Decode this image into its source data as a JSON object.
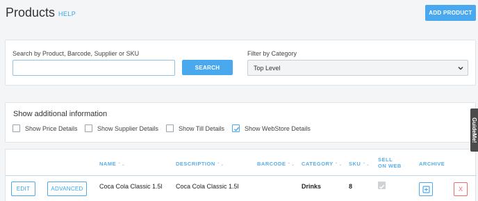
{
  "header": {
    "title": "Products",
    "help_label": "HELP",
    "add_label": "ADD PRODUCT"
  },
  "search": {
    "label": "Search by Product, Barcode, Supplier or SKU",
    "value": "",
    "button_label": "SEARCH",
    "filter_label": "Filter by Category",
    "filter_value": "Top Level"
  },
  "additional_info": {
    "title": "Show additional information",
    "options": [
      {
        "label": "Show Price Details",
        "checked": false
      },
      {
        "label": "Show Supplier Details",
        "checked": false
      },
      {
        "label": "Show Till Details",
        "checked": false
      },
      {
        "label": "Show WebStore Details",
        "checked": true
      }
    ]
  },
  "table": {
    "columns": {
      "name": "NAME",
      "description": "DESCRIPTION",
      "barcode": "BARCODE",
      "category": "CATEGORY",
      "sku": "SKU",
      "sell_on_web_1": "SELL",
      "sell_on_web_2": "ON WEB",
      "archive": "ARCHIVE"
    },
    "sort_glyph": "⌃⌄",
    "rows": [
      {
        "edit_label": "EDIT",
        "advanced_label": "ADVANCED",
        "name": "Coca Cola Classic 1.5l",
        "description": "Coca Cola Classic 1.5l",
        "barcode": "",
        "category": "Drinks",
        "sku": "8",
        "sell_on_web": true,
        "delete_label": "X"
      }
    ]
  },
  "guideme_label": "GuideMe!",
  "colors": {
    "accent": "#4aa8ef",
    "danger": "#f06b6b"
  }
}
